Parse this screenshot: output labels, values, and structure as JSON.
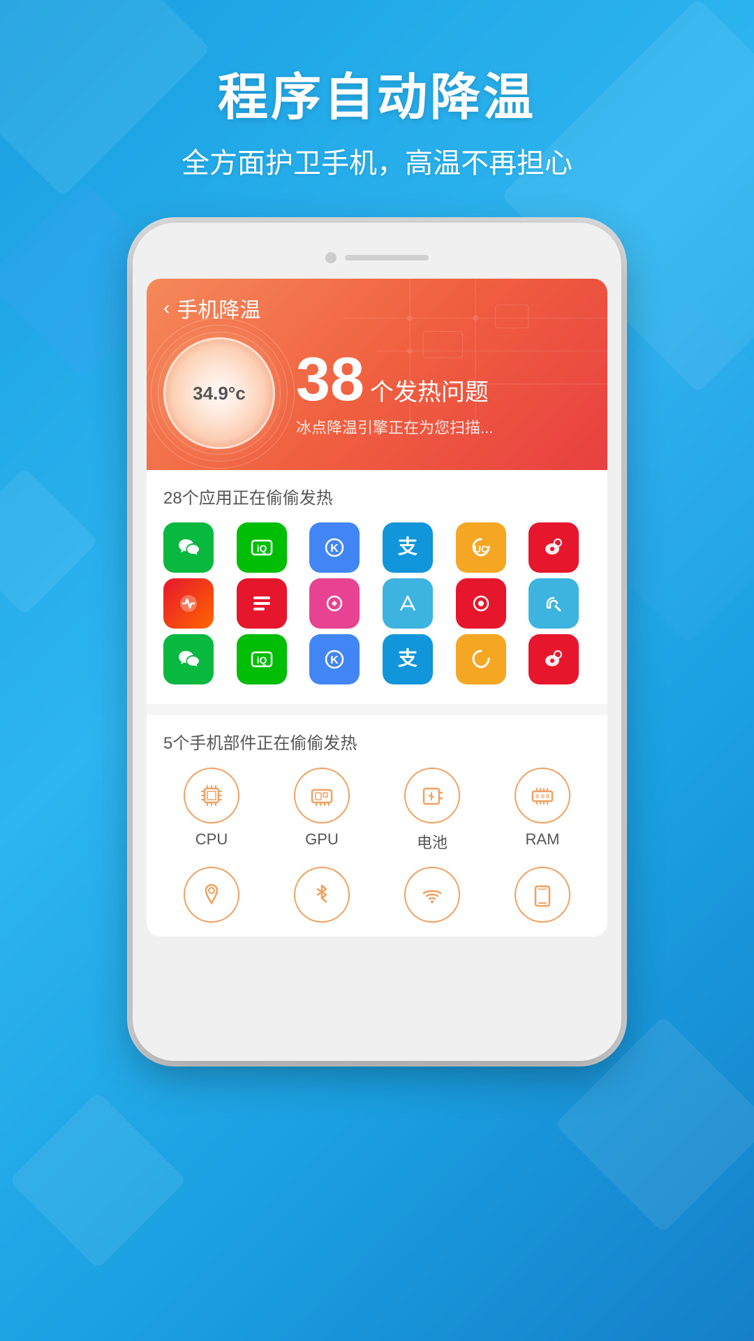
{
  "background": {
    "gradient_start": "#1a9fe0",
    "gradient_end": "#1580c8"
  },
  "header": {
    "title": "程序自动降温",
    "subtitle": "全方面护卫手机，高温不再担心"
  },
  "app": {
    "nav_title": "手机降温",
    "back_label": "‹",
    "temperature": "34.9°c",
    "issue_count": "38",
    "issue_label": "个发热问题",
    "scan_desc": "冰点降温引擎正在为您扫描...",
    "apps_section_title": "28个应用正在偷偷发热",
    "components_section_title": "5个手机部件正在偷偷发热",
    "components": [
      {
        "id": "cpu",
        "label": "CPU",
        "icon": "cpu"
      },
      {
        "id": "gpu",
        "label": "GPU",
        "icon": "gpu"
      },
      {
        "id": "battery",
        "label": "电池",
        "icon": "battery"
      },
      {
        "id": "ram",
        "label": "RAM",
        "icon": "ram"
      },
      {
        "id": "location",
        "label": "",
        "icon": "location"
      },
      {
        "id": "bluetooth",
        "label": "",
        "icon": "bluetooth"
      },
      {
        "id": "wifi",
        "label": "",
        "icon": "wifi"
      },
      {
        "id": "screen",
        "label": "",
        "icon": "screen"
      }
    ],
    "app_rows": [
      [
        "wechat",
        "iqiyi",
        "kuaikan",
        "alipay",
        "uc",
        "weibo"
      ],
      [
        "health",
        "toutiao",
        "meipai",
        "amap",
        "music",
        "sogou"
      ],
      [
        "wechat",
        "iqiyi",
        "kuaikan",
        "alipay",
        "uc",
        "weibo"
      ]
    ]
  }
}
